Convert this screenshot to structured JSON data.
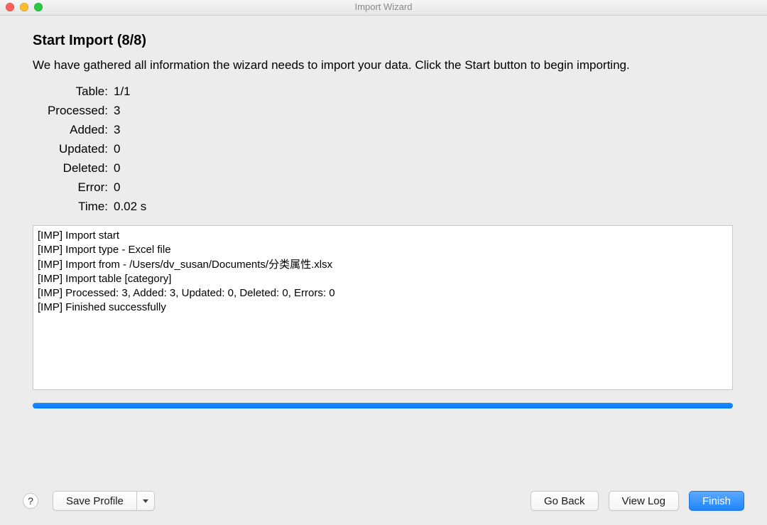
{
  "window": {
    "title": "Import Wizard"
  },
  "page": {
    "heading": "Start Import (8/8)",
    "description": "We have gathered all information the wizard needs to import your data. Click the Start button to begin importing."
  },
  "stats": {
    "table_label": "Table:",
    "table_value": "1/1",
    "processed_label": "Processed:",
    "processed_value": "3",
    "added_label": "Added:",
    "added_value": "3",
    "updated_label": "Updated:",
    "updated_value": "0",
    "deleted_label": "Deleted:",
    "deleted_value": "0",
    "error_label": "Error:",
    "error_value": "0",
    "time_label": "Time:",
    "time_value": "0.02 s"
  },
  "log_text": "[IMP] Import start\n[IMP] Import type - Excel file\n[IMP] Import from - /Users/dv_susan/Documents/分类属性.xlsx\n[IMP] Import table [category]\n[IMP] Processed: 3, Added: 3, Updated: 0, Deleted: 0, Errors: 0\n[IMP] Finished successfully",
  "progress_percent": 100,
  "buttons": {
    "help": "?",
    "save_profile": "Save Profile",
    "go_back": "Go Back",
    "view_log": "View Log",
    "finish": "Finish"
  }
}
